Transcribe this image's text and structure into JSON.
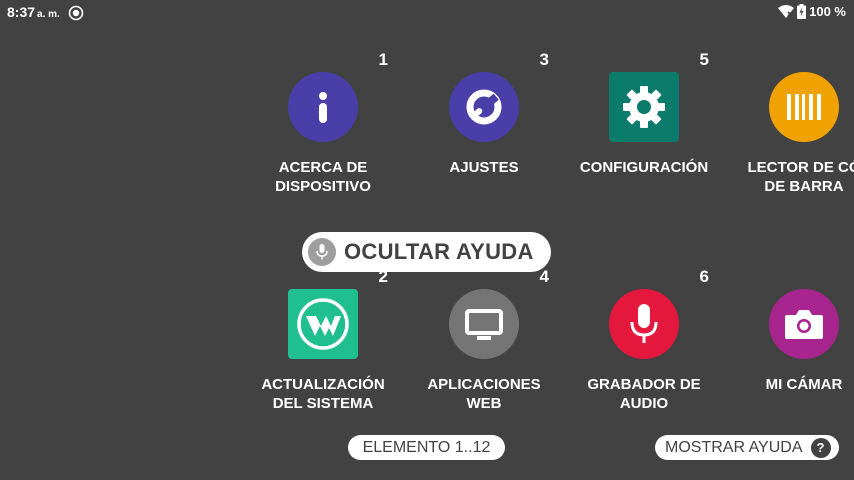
{
  "status_bar": {
    "time": "8:37",
    "ampm": "a. m.",
    "battery": "100 %"
  },
  "apps": [
    {
      "index": "1",
      "label_line1": "ACERCA DE",
      "label_line2": "DISPOSITIVO",
      "color": "#4a3fa8",
      "icon": "info-icon"
    },
    {
      "index": "3",
      "label_line1": "AJUSTES",
      "label_line2": "",
      "color": "#4a3fa8",
      "icon": "wrench-icon"
    },
    {
      "index": "5",
      "label_line1": "CONFIGURACIÓN",
      "label_line2": "",
      "color": "#0b7c6b",
      "icon": "gear-icon"
    },
    {
      "index": "",
      "label_line1": "LECTOR DE CÓ",
      "label_line2": "DE BARRA",
      "color": "#f0a202",
      "icon": "barcode-icon"
    },
    {
      "index": "2",
      "label_line1": "ACTUALIZACIÓN",
      "label_line2": "DEL SISTEMA",
      "color": "#1fbf8f",
      "icon": "update-logo-icon"
    },
    {
      "index": "4",
      "label_line1": "APLICACIONES",
      "label_line2": "WEB",
      "color": "#757575",
      "icon": "monitor-icon"
    },
    {
      "index": "6",
      "label_line1": "GRABADOR DE",
      "label_line2": "AUDIO",
      "color": "#e5193d",
      "icon": "microphone-icon"
    },
    {
      "index": "",
      "label_line1": "MI CÁMAR",
      "label_line2": "",
      "color": "#a8248f",
      "icon": "camera-icon"
    }
  ],
  "hide_help_label": "OCULTAR AYUDA",
  "element_range_label": "ELEMENTO 1..12",
  "show_help_label": "MOSTRAR AYUDA",
  "show_help_icon": "?"
}
